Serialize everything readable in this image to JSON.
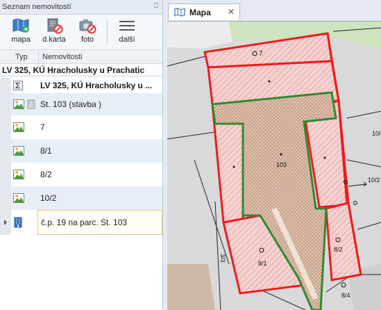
{
  "panel": {
    "title": "Seznam nemovitostí",
    "pin_icon": "pin-icon"
  },
  "toolbar": {
    "map_label": "mapa",
    "dkarta_label": "d.karta",
    "foto_label": "foto",
    "more_label": "další"
  },
  "columns": {
    "type": "Typ",
    "property": "Nemovitosti"
  },
  "group": {
    "label": "LV 325, KÚ Hracholusky u Prachatic"
  },
  "rows": [
    {
      "text": "LV 325, KÚ Hracholusky u ...",
      "icon": "sum-icon"
    },
    {
      "text": "St. 103  (stavba  )",
      "icon": "parcel-image-icon"
    },
    {
      "text": "7",
      "icon": "parcel-image-icon"
    },
    {
      "text": "8/1",
      "icon": "parcel-image-icon"
    },
    {
      "text": "8/2",
      "icon": "parcel-image-icon"
    },
    {
      "text": "10/2",
      "icon": "parcel-image-icon"
    },
    {
      "text": "č.p. 19  na parc. St. 103",
      "icon": "building-icon"
    }
  ],
  "tabs": {
    "map_tab": "Mapa"
  },
  "map": {
    "labels": [
      "7",
      "103",
      "8/1",
      "8/2",
      "10/2",
      "8/4",
      "3/3",
      "10/"
    ],
    "colors": {
      "highlight_red": "#ee1c1c",
      "owner_green": "#2e8b2e"
    }
  }
}
